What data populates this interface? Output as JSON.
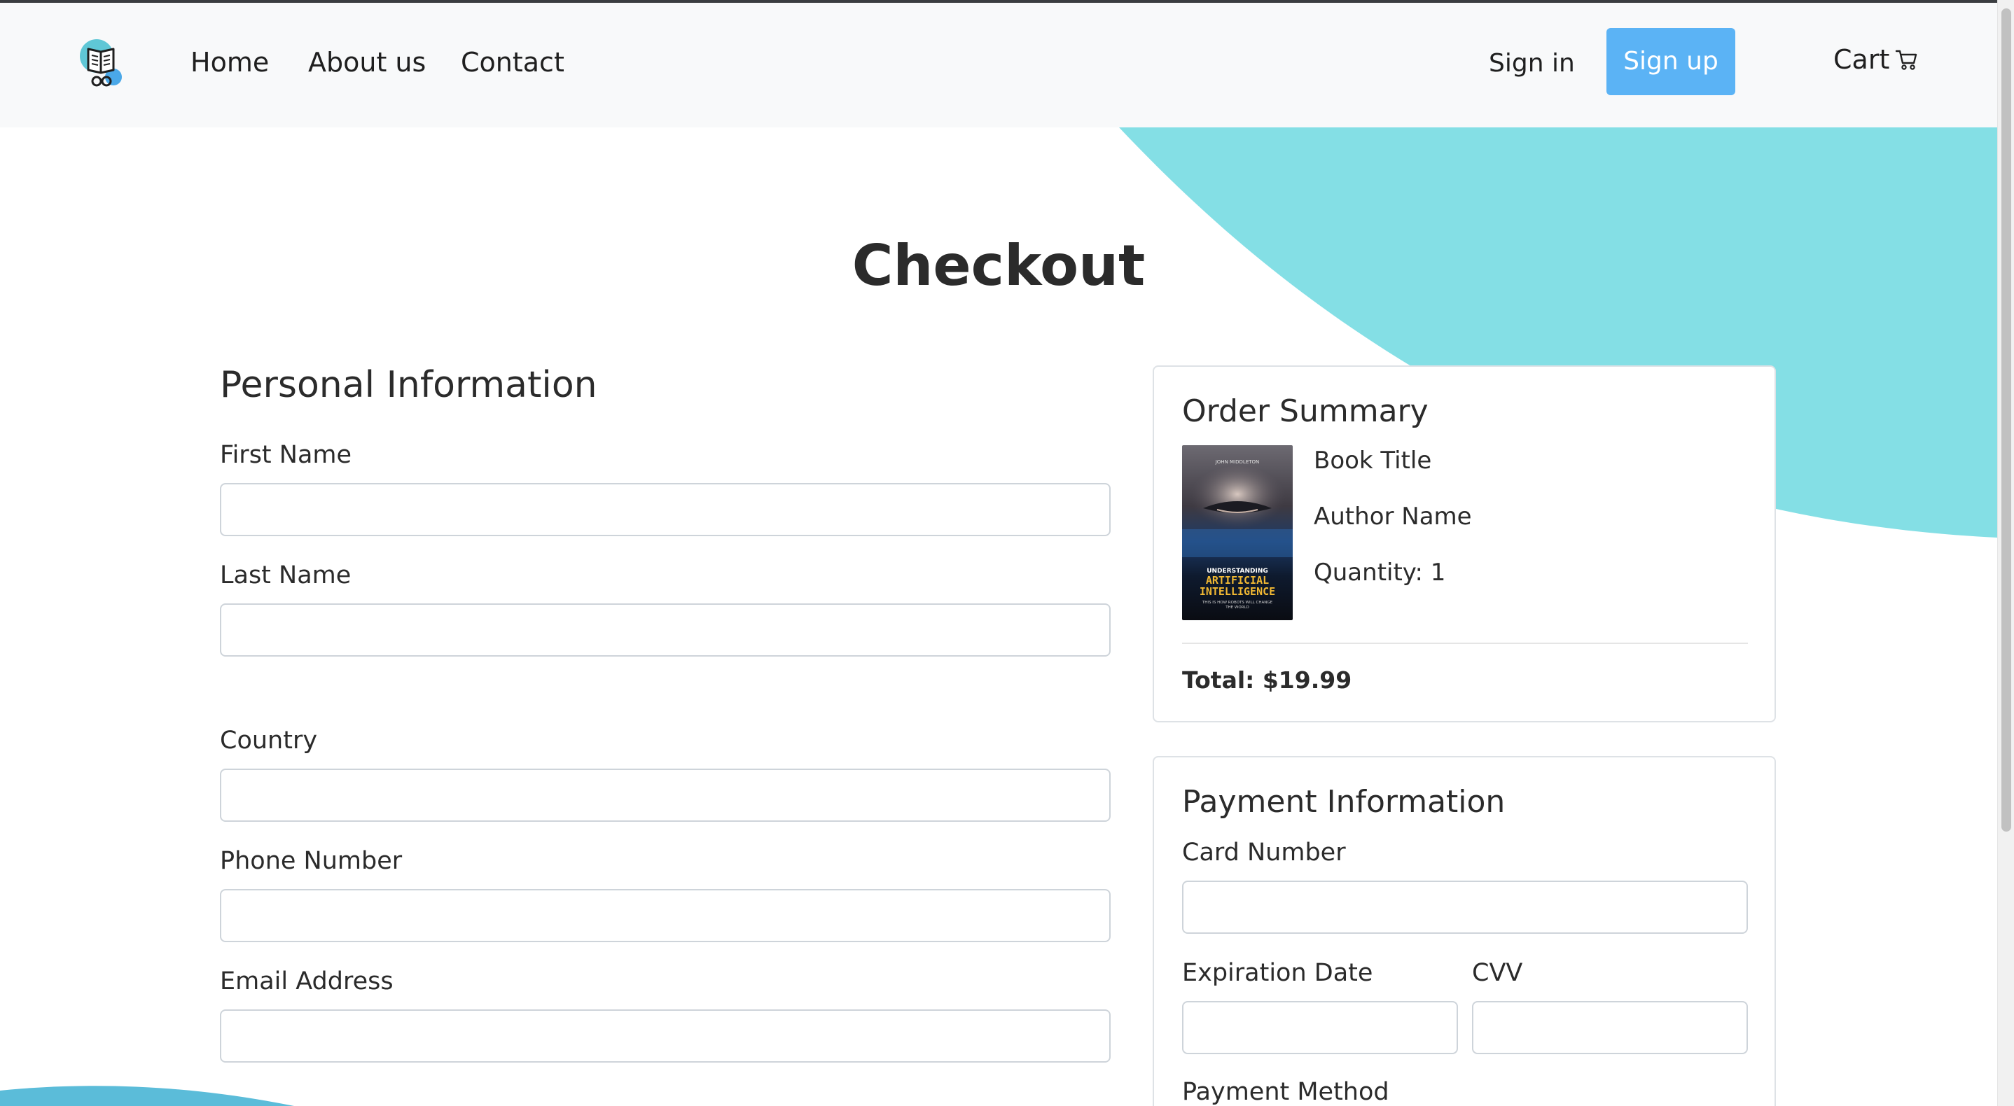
{
  "nav": {
    "home": "Home",
    "about": "About us",
    "contact": "Contact",
    "sign_in": "Sign in",
    "sign_up": "Sign up",
    "cart": "Cart"
  },
  "icons": {
    "logo": "book-reader-logo-icon",
    "cart": "shopping-cart-icon"
  },
  "colors": {
    "accent_blob": "#84dfe5",
    "sign_up_bg": "#5bb3f5",
    "bottom_blob": "#5bbcd9"
  },
  "page_title": "Checkout",
  "personal": {
    "heading": "Personal Information",
    "first_name_label": "First Name",
    "first_name_value": "",
    "last_name_label": "Last Name",
    "last_name_value": "",
    "country_label": "Country",
    "country_value": "",
    "phone_label": "Phone Number",
    "phone_value": "",
    "email_label": "Email Address",
    "email_value": ""
  },
  "summary": {
    "heading": "Order Summary",
    "book_title": "Book Title",
    "author": "Author Name",
    "quantity": "Quantity: 1",
    "total": "Total: $19.99",
    "cover": {
      "author": "JOHN MIDDLETON",
      "line1": "UNDERSTANDING",
      "line2": "ARTIFICIAL",
      "line3": "INTELLIGENCE",
      "tagline1": "THIS IS HOW ROBOTS WILL CHANGE",
      "tagline2": "THE WORLD"
    }
  },
  "payment": {
    "heading": "Payment Information",
    "card_number_label": "Card Number",
    "card_number_value": "",
    "expiration_label": "Expiration Date",
    "expiration_value": "",
    "cvv_label": "CVV",
    "cvv_value": "",
    "method_label": "Payment Method"
  }
}
